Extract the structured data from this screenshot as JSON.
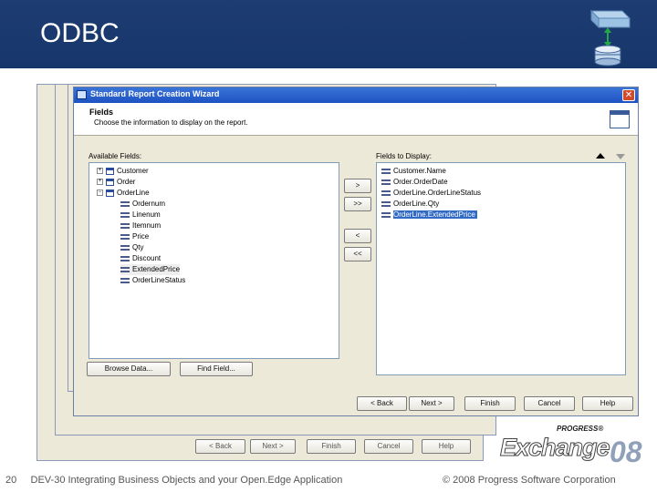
{
  "slide": {
    "title": "ODBC",
    "page_number": "20",
    "footer_left": "DEV-30 Integrating Business Objects and your Open.Edge Application",
    "footer_right": "© 2008 Progress Software Corporation",
    "logo_brand": "PROGRESS®",
    "logo_word": "Exchange",
    "logo_year": "08"
  },
  "colors": {
    "header_blue": "#1d3c72",
    "titlebar_blue": "#1d52c2",
    "selection_blue": "#316ac5",
    "window_face": "#ece9d8"
  },
  "back_window": {
    "buttons": [
      "< Back",
      "Next >",
      "Finish",
      "Cancel",
      "Help"
    ]
  },
  "dialog": {
    "title": "Standard Report Creation Wizard",
    "close_symbol": "✕",
    "section_title": "Fields",
    "section_desc": "Choose the information to display on the report.",
    "available_label": "Available Fields:",
    "display_label": "Fields to Display:",
    "tree": [
      {
        "label": "Customer",
        "type": "table",
        "toggle": "+"
      },
      {
        "label": "Order",
        "type": "table",
        "toggle": "+"
      },
      {
        "label": "OrderLine",
        "type": "table",
        "toggle": "-"
      },
      {
        "label": "Ordernum",
        "type": "field"
      },
      {
        "label": "Linenum",
        "type": "field"
      },
      {
        "label": "Itemnum",
        "type": "field"
      },
      {
        "label": "Price",
        "type": "field"
      },
      {
        "label": "Qty",
        "type": "field"
      },
      {
        "label": "Discount",
        "type": "field"
      },
      {
        "label": "ExtendedPrice",
        "type": "field"
      },
      {
        "label": "OrderLineStatus",
        "type": "field"
      }
    ],
    "display_fields": [
      "Customer.Name",
      "Order.OrderDate",
      "OrderLine.OrderLineStatus",
      "OrderLine.Qty",
      "OrderLine.ExtendedPrice"
    ],
    "selected_display_index": 4,
    "move_buttons": [
      ">",
      ">>",
      "<",
      "<<"
    ],
    "browse_button": "Browse Data...",
    "find_button": "Find Field...",
    "nav_buttons": [
      "< Back",
      "Next >",
      "Finish",
      "Cancel",
      "Help"
    ]
  }
}
